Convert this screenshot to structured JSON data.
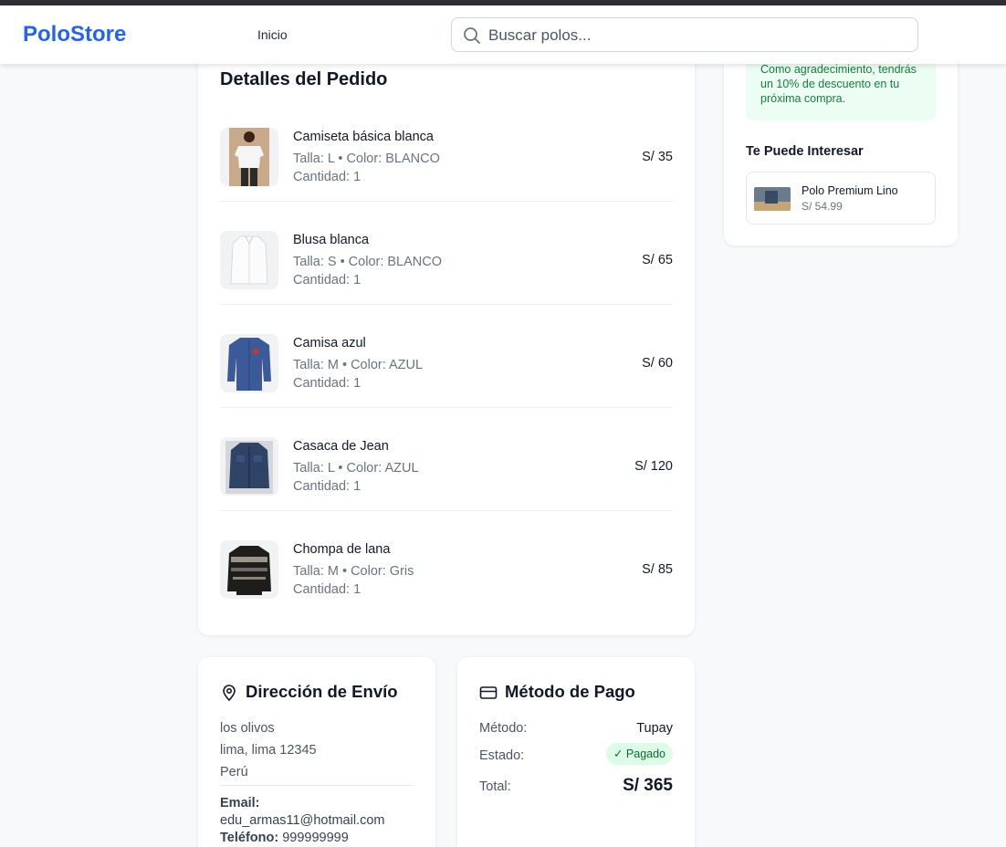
{
  "header": {
    "logo": "PoloStore",
    "nav_home": "Inicio",
    "search_placeholder": "Buscar polos..."
  },
  "order": {
    "title": "Detalles del Pedido",
    "items": [
      {
        "name": "Camiseta básica blanca",
        "attrs": "Talla: L • Color: BLANCO",
        "qty": "Cantidad: 1",
        "price": "S/ 35",
        "thumb": "white-tshirt"
      },
      {
        "name": "Blusa blanca",
        "attrs": "Talla: S • Color: BLANCO",
        "qty": "Cantidad: 1",
        "price": "S/ 65",
        "thumb": "white-blouse"
      },
      {
        "name": "Camisa azul",
        "attrs": "Talla: M • Color: AZUL",
        "qty": "Cantidad: 1",
        "price": "S/ 60",
        "thumb": "blue-shirt"
      },
      {
        "name": "Casaca de Jean",
        "attrs": "Talla: L • Color: AZUL",
        "qty": "Cantidad: 1",
        "price": "S/ 120",
        "thumb": "denim-jacket"
      },
      {
        "name": "Chompa de lana",
        "attrs": "Talla: M • Color: Gris",
        "qty": "Cantidad: 1",
        "price": "S/ 85",
        "thumb": "wool-sweater"
      }
    ]
  },
  "sidebar": {
    "thanks_text": "Como agradecimiento, tendrás un 10% de descuento en tu próxima compra.",
    "suggest_title": "Te Puede Interesar",
    "suggest_item": {
      "name": "Polo Premium Lino",
      "price": "S/ 54.99"
    }
  },
  "shipping": {
    "title": "Dirección de Envío",
    "line1": "los olivos",
    "line2": "lima, lima 12345",
    "line3": "Perú",
    "email_label": "Email:",
    "email": "edu_armas11@hotmail.com",
    "phone_label": "Teléfono:",
    "phone": "999999999"
  },
  "payment": {
    "title": "Método de Pago",
    "method_label": "Método:",
    "method_value": "Tupay",
    "status_label": "Estado:",
    "status_value": "✓ Pagado",
    "total_label": "Total:",
    "total_value": "S/ 365"
  },
  "colors": {
    "brand": "#2563eb",
    "success_bg": "#ecfdf3",
    "success_text": "#15803d",
    "badge_bg": "#dcfce7"
  }
}
